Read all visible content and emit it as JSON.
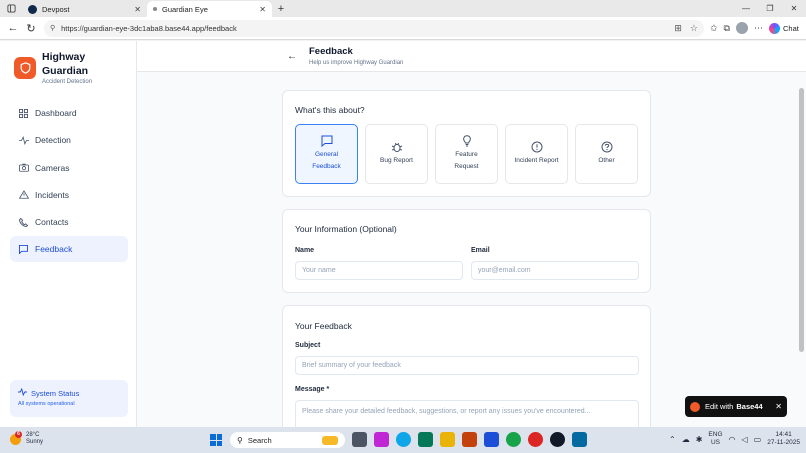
{
  "browser": {
    "tabs": [
      {
        "title": "Devpost",
        "active": false,
        "favicon_color": "#0f2a4a"
      },
      {
        "title": "Guardian Eye",
        "active": true,
        "favicon_color": "#888888"
      }
    ],
    "new_tab_label": "+",
    "url": "https://guardian-eye-3dc1aba8.base44.app/feedback",
    "chat_label": "Chat"
  },
  "sidebar": {
    "brand_name": "Highway Guardian",
    "brand_sub": "Accident Detection",
    "brand_color": "#f05a28",
    "items": [
      {
        "label": "Dashboard",
        "icon": "grid-icon",
        "active": false
      },
      {
        "label": "Detection",
        "icon": "activity-icon",
        "active": false
      },
      {
        "label": "Cameras",
        "icon": "camera-icon",
        "active": false
      },
      {
        "label": "Incidents",
        "icon": "alert-triangle-icon",
        "active": false
      },
      {
        "label": "Contacts",
        "icon": "phone-icon",
        "active": false
      },
      {
        "label": "Feedback",
        "icon": "message-square-icon",
        "active": true
      }
    ],
    "status": {
      "title": "System Status",
      "subtitle": "All systems operational"
    }
  },
  "header": {
    "title": "Feedback",
    "subtitle": "Help us improve Highway Guardian"
  },
  "about_card": {
    "title": "What's this about?",
    "categories": [
      {
        "label": "General Feedback",
        "icon": "message-square-icon",
        "selected": true
      },
      {
        "label": "Bug Report",
        "icon": "bug-icon",
        "selected": false
      },
      {
        "label": "Feature Request",
        "icon": "lightbulb-icon",
        "selected": false
      },
      {
        "label": "Incident Report",
        "icon": "alert-circle-icon",
        "selected": false
      },
      {
        "label": "Other",
        "icon": "help-circle-icon",
        "selected": false
      }
    ]
  },
  "info_card": {
    "title": "Your Information (Optional)",
    "name_label": "Name",
    "name_placeholder": "Your name",
    "email_label": "Email",
    "email_placeholder": "your@email.com"
  },
  "feedback_card": {
    "title": "Your Feedback",
    "subject_label": "Subject",
    "subject_placeholder": "Brief summary of your feedback",
    "message_label": "Message *",
    "message_placeholder": "Please share your detailed feedback, suggestions, or report any issues you've encountered..."
  },
  "base44_badge": {
    "prefix": "Edit with",
    "brand": "Base44"
  },
  "taskbar": {
    "weather_temp": "28°C",
    "weather_desc": "Sunny",
    "weather_badge": "6",
    "search_label": "Search",
    "lang_top": "ENG",
    "lang_bottom": "US",
    "time": "14:41",
    "date": "27-11-2025"
  },
  "colors": {
    "accent": "#2563eb",
    "selected_bg": "#eff6ff",
    "active_nav_bg": "#eef2ff"
  }
}
